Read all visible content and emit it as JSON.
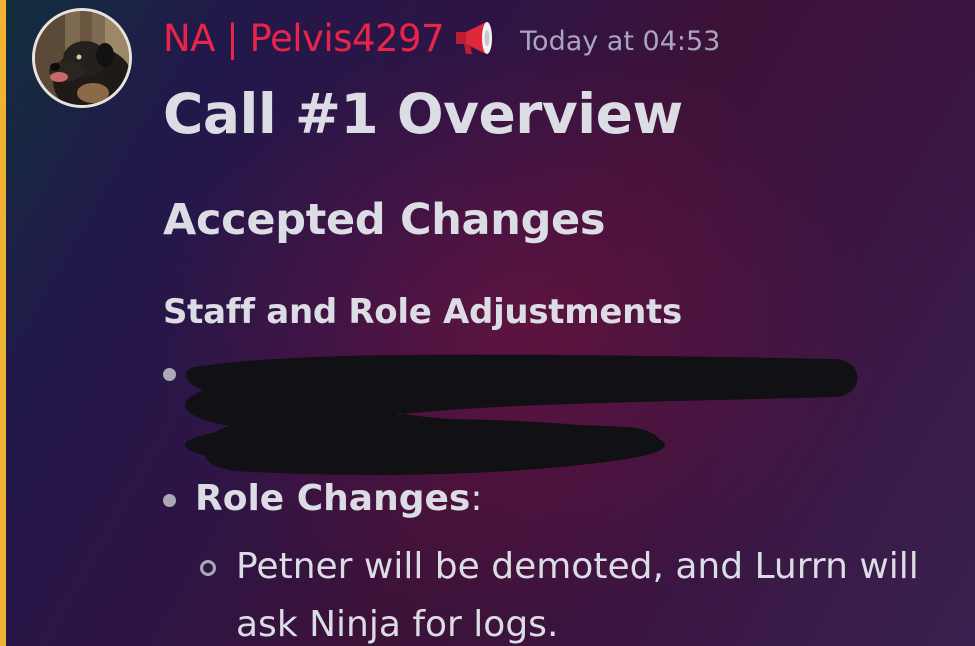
{
  "message": {
    "author": {
      "display_name": "NA | Pelvis4297",
      "name_color": "#e8244b",
      "badge_icon": "megaphone-icon",
      "avatar": "dog-avatar"
    },
    "timestamp": "Today at 04:53",
    "accent_color": "#f0b232",
    "content": {
      "h1": "Call #1 Overview",
      "h2": "Accepted Changes",
      "h3": "Staff and Role Adjustments",
      "list": [
        {
          "text": "",
          "redacted": true
        },
        {
          "label": "Role Changes",
          "suffix": ":",
          "subitems": [
            {
              "line1": "Petner will be demoted, and Lurrn will",
              "line2": "ask Ninja for logs."
            }
          ]
        }
      ]
    }
  }
}
